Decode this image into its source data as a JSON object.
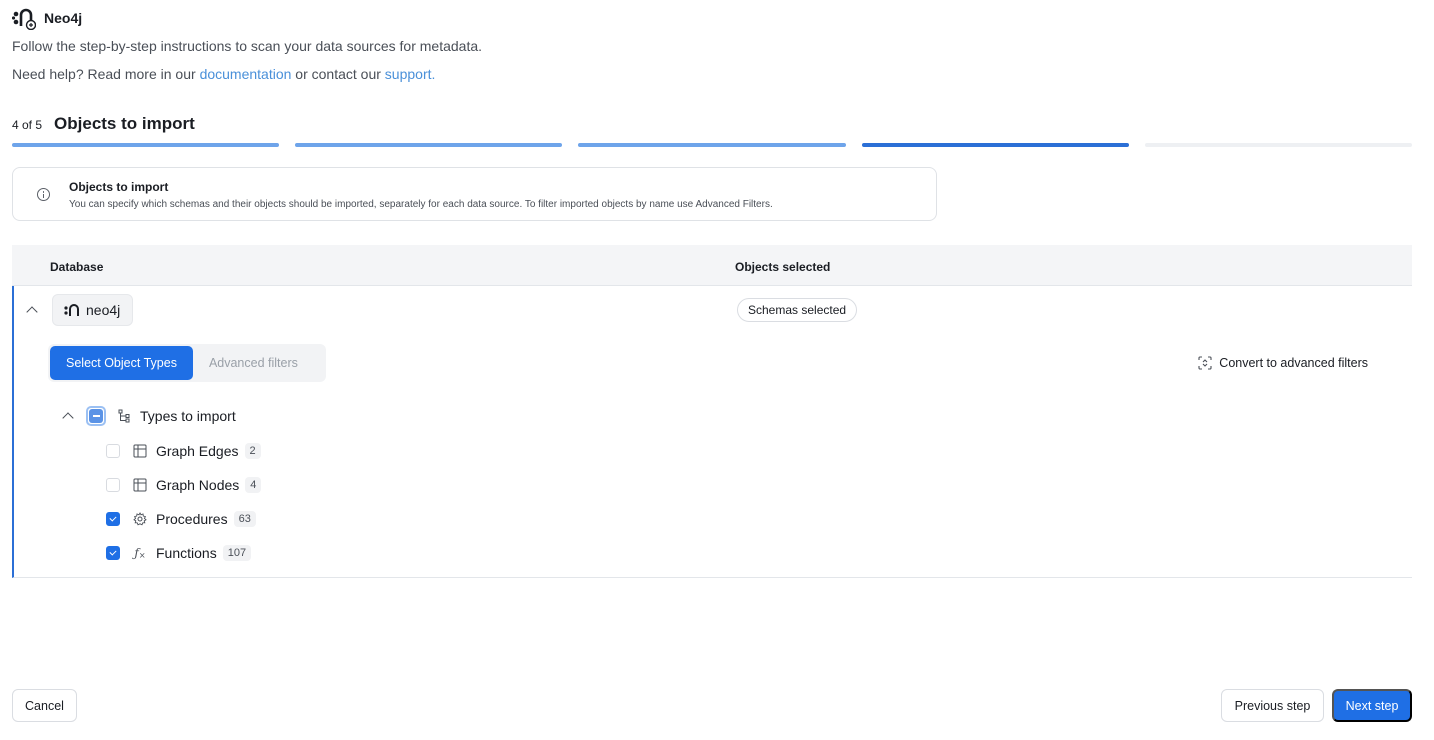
{
  "app": {
    "title": "Neo4j",
    "logo_icon": "neo4j-logo-icon"
  },
  "intro": "Follow the step-by-step instructions to scan your data sources for metadata.",
  "help": {
    "prefix": "Need help? Read more in our ",
    "doc_link": "documentation",
    "middle": " or contact our ",
    "support_link": "support."
  },
  "stepper": {
    "count": "4 of 5",
    "title": "Objects to import",
    "current_step": 4,
    "total_steps": 5,
    "colors": {
      "done": "#6ea4ea",
      "current": "#2b6fd6",
      "todo": "#eef0f3"
    }
  },
  "info": {
    "icon": "info-icon",
    "title": "Objects to import",
    "description": "You can specify which schemas and their objects should be imported, separately for each data source. To filter imported objects by name use Advanced Filters."
  },
  "table": {
    "columns": [
      "Database",
      "Objects selected"
    ],
    "row": {
      "database": "neo4j",
      "selected": "Schemas selected",
      "tabs": [
        "Select Object Types",
        "Advanced filters"
      ],
      "active_tab": "Select Object Types",
      "convert_label": "Convert to advanced filters",
      "tree": {
        "root_label": "Types to import",
        "root_state": "indeterminate",
        "items": [
          {
            "name": "Graph Edges",
            "count": "2",
            "checked": false,
            "icon": "table-icon"
          },
          {
            "name": "Graph Nodes",
            "count": "4",
            "checked": false,
            "icon": "table-icon"
          },
          {
            "name": "Procedures",
            "count": "63",
            "checked": true,
            "icon": "gear-icon"
          },
          {
            "name": "Functions",
            "count": "107",
            "checked": true,
            "icon": "function-icon"
          }
        ]
      }
    }
  },
  "footer": {
    "cancel": "Cancel",
    "previous": "Previous step",
    "next": "Next step"
  },
  "accent_color": "#1f6fe5"
}
